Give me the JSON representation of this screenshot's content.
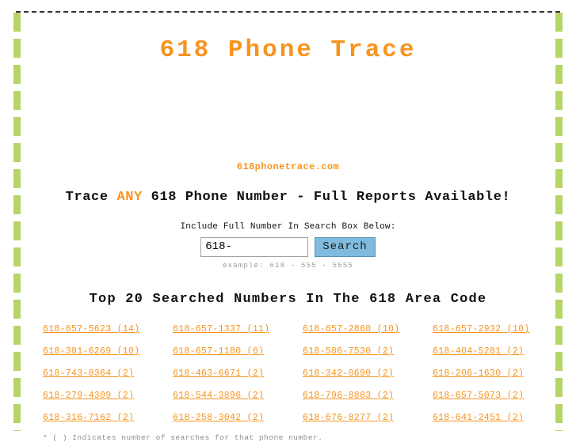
{
  "site": {
    "title": "618 Phone Trace",
    "domain": "618phonetrace.com",
    "tagline_before": "Trace ",
    "tagline_highlight": "ANY",
    "tagline_after": " 618 Phone Number - Full Reports Available!",
    "accent_color": "#f7941e",
    "rail_color": "#b5d666",
    "button_color": "#7fbbdf"
  },
  "search": {
    "label": "Include Full Number In Search Box Below:",
    "value": "618-",
    "placeholder": "618-",
    "button_label": "Search",
    "example": "example: 618 - 555 - 5555"
  },
  "top_list": {
    "heading": "Top 20 Searched Numbers In The 618 Area Code",
    "footnote": "* ( ) Indicates number of searches for that phone number.",
    "rows": [
      [
        {
          "number": "618-657-5623",
          "count": "(14)",
          "label": "618-657-5623 (14)"
        },
        {
          "number": "618-657-1337",
          "count": "(11)",
          "label": "618-657-1337 (11)"
        },
        {
          "number": "618-657-2860",
          "count": "(10)",
          "label": "618-657-2860 (10)"
        },
        {
          "number": "618-657-2932",
          "count": "(10)",
          "label": "618-657-2932 (10)"
        }
      ],
      [
        {
          "number": "618-381-6269",
          "count": "(10)",
          "label": "618-381-6269 (10)"
        },
        {
          "number": "618-657-1180",
          "count": "(6)",
          "label": "618-657-1180 (6)"
        },
        {
          "number": "618-586-7530",
          "count": "(2)",
          "label": "618-586-7530 (2)"
        },
        {
          "number": "618-404-5281",
          "count": "(2)",
          "label": "618-404-5281 (2)"
        }
      ],
      [
        {
          "number": "618-743-8364",
          "count": "(2)",
          "label": "618-743-8364 (2)"
        },
        {
          "number": "618-463-6671",
          "count": "(2)",
          "label": "618-463-6671 (2)"
        },
        {
          "number": "618-342-0690",
          "count": "(2)",
          "label": "618-342-0690 (2)"
        },
        {
          "number": "618-206-1630",
          "count": "(2)",
          "label": "618-206-1630 (2)"
        }
      ],
      [
        {
          "number": "618-279-4309",
          "count": "(2)",
          "label": "618-279-4309 (2)"
        },
        {
          "number": "618-544-3896",
          "count": "(2)",
          "label": "618-544-3896 (2)"
        },
        {
          "number": "618-796-8803",
          "count": "(2)",
          "label": "618-796-8803 (2)"
        },
        {
          "number": "618-657-5073",
          "count": "(2)",
          "label": "618-657-5073 (2)"
        }
      ],
      [
        {
          "number": "618-316-7162",
          "count": "(2)",
          "label": "618-316-7162 (2)"
        },
        {
          "number": "618-258-3042",
          "count": "(2)",
          "label": "618-258-3042 (2)"
        },
        {
          "number": "618-676-8277",
          "count": "(2)",
          "label": "618-676-8277 (2)"
        },
        {
          "number": "618-641-2451",
          "count": "(2)",
          "label": "618-641-2451 (2)"
        }
      ]
    ]
  }
}
